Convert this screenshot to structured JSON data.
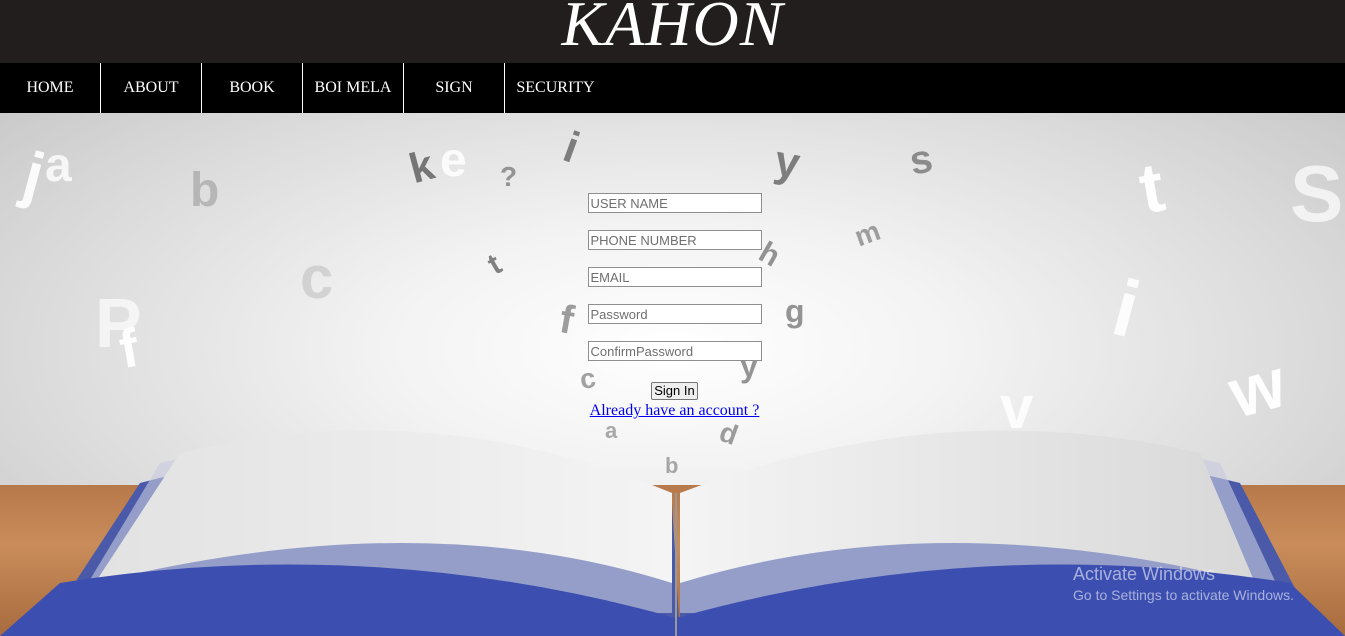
{
  "header": {
    "logo": "KAHON"
  },
  "nav": {
    "items": [
      {
        "label": "HOME"
      },
      {
        "label": "ABOUT"
      },
      {
        "label": "BOOK"
      },
      {
        "label": "BOI MELA"
      },
      {
        "label": "SIGN"
      },
      {
        "label": "SECURITY"
      }
    ]
  },
  "form": {
    "username": {
      "placeholder": "USER NAME",
      "value": ""
    },
    "phone": {
      "placeholder": "PHONE NUMBER",
      "value": ""
    },
    "email": {
      "placeholder": "EMAIL",
      "value": ""
    },
    "password": {
      "placeholder": "Password",
      "value": ""
    },
    "confirm_password": {
      "placeholder": "ConfirmPassword",
      "value": ""
    },
    "signin_label": "Sign In",
    "account_link": "Already have an account ?"
  },
  "watermark": {
    "title": "Activate Windows",
    "subtitle": "Go to Settings to activate Windows."
  },
  "colors": {
    "header_bg": "#211e1d",
    "nav_bg": "#000000",
    "link": "#0000ee"
  }
}
